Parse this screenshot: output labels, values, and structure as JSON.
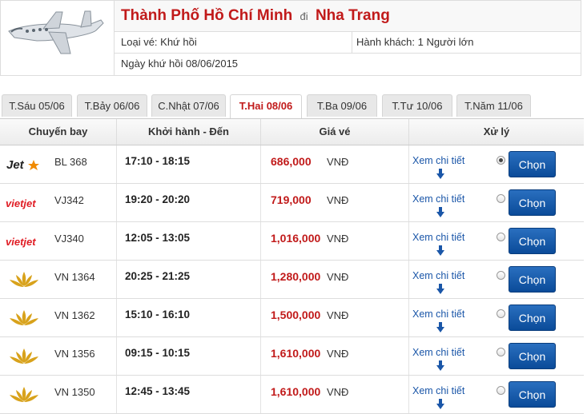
{
  "search": {
    "origin": "Thành Phố Hồ Chí Minh",
    "connector": "đi",
    "destination": "Nha Trang",
    "ticket_type": "Loại vé: Khứ hồi",
    "passengers": "Hành khách: 1 Người lớn",
    "return_date": "Ngày khứ hồi 08/06/2015"
  },
  "tabs": [
    {
      "label": "T.Sáu 05/06",
      "active": false
    },
    {
      "label": "T.Bảy 06/06",
      "active": false
    },
    {
      "label": "C.Nhật 07/06",
      "active": false
    },
    {
      "label": "T.Hai 08/06",
      "active": true
    },
    {
      "label": "T.Ba 09/06",
      "active": false
    },
    {
      "label": "T.Tư 10/06",
      "active": false
    },
    {
      "label": "T.Năm 11/06",
      "active": false
    }
  ],
  "table": {
    "headers": {
      "airline": "Chuyến bay",
      "time": "Khởi hành - Đến",
      "price": "Giá vé",
      "action": "Xử lý"
    },
    "detail_label": "Xem chi tiết",
    "choose_label": "Chọn",
    "rows": [
      {
        "airline": "jetstar-logo",
        "flight": "BL 368",
        "time": "17:10 - 18:15",
        "price": "686,000",
        "currency": "VNĐ",
        "selected": true
      },
      {
        "airline": "vietjet-logo",
        "flight": "VJ342",
        "time": "19:20 - 20:20",
        "price": "719,000",
        "currency": "VNĐ",
        "selected": false
      },
      {
        "airline": "vietjet-logo",
        "flight": "VJ340",
        "time": "12:05 - 13:05",
        "price": "1,016,000",
        "currency": "VNĐ",
        "selected": false
      },
      {
        "airline": "vietnam-airlines-logo",
        "flight": "VN 1364",
        "time": "20:25 - 21:25",
        "price": "1,280,000",
        "currency": "VNĐ",
        "selected": false
      },
      {
        "airline": "vietnam-airlines-logo",
        "flight": "VN 1362",
        "time": "15:10 - 16:10",
        "price": "1,500,000",
        "currency": "VNĐ",
        "selected": false
      },
      {
        "airline": "vietnam-airlines-logo",
        "flight": "VN 1356",
        "time": "09:15 - 10:15",
        "price": "1,610,000",
        "currency": "VNĐ",
        "selected": false
      },
      {
        "airline": "vietnam-airlines-logo",
        "flight": "VN 1350",
        "time": "12:45 - 13:45",
        "price": "1,610,000",
        "currency": "VNĐ",
        "selected": false
      }
    ]
  },
  "logos": {
    "jetstar_text": "Jet",
    "vietjet_text": "vietjet"
  },
  "colors": {
    "accent_red": "#c11a1a",
    "button_blue": "#0b4b99",
    "link_blue": "#1a56a8",
    "vna_gold": "#d8a21b"
  }
}
